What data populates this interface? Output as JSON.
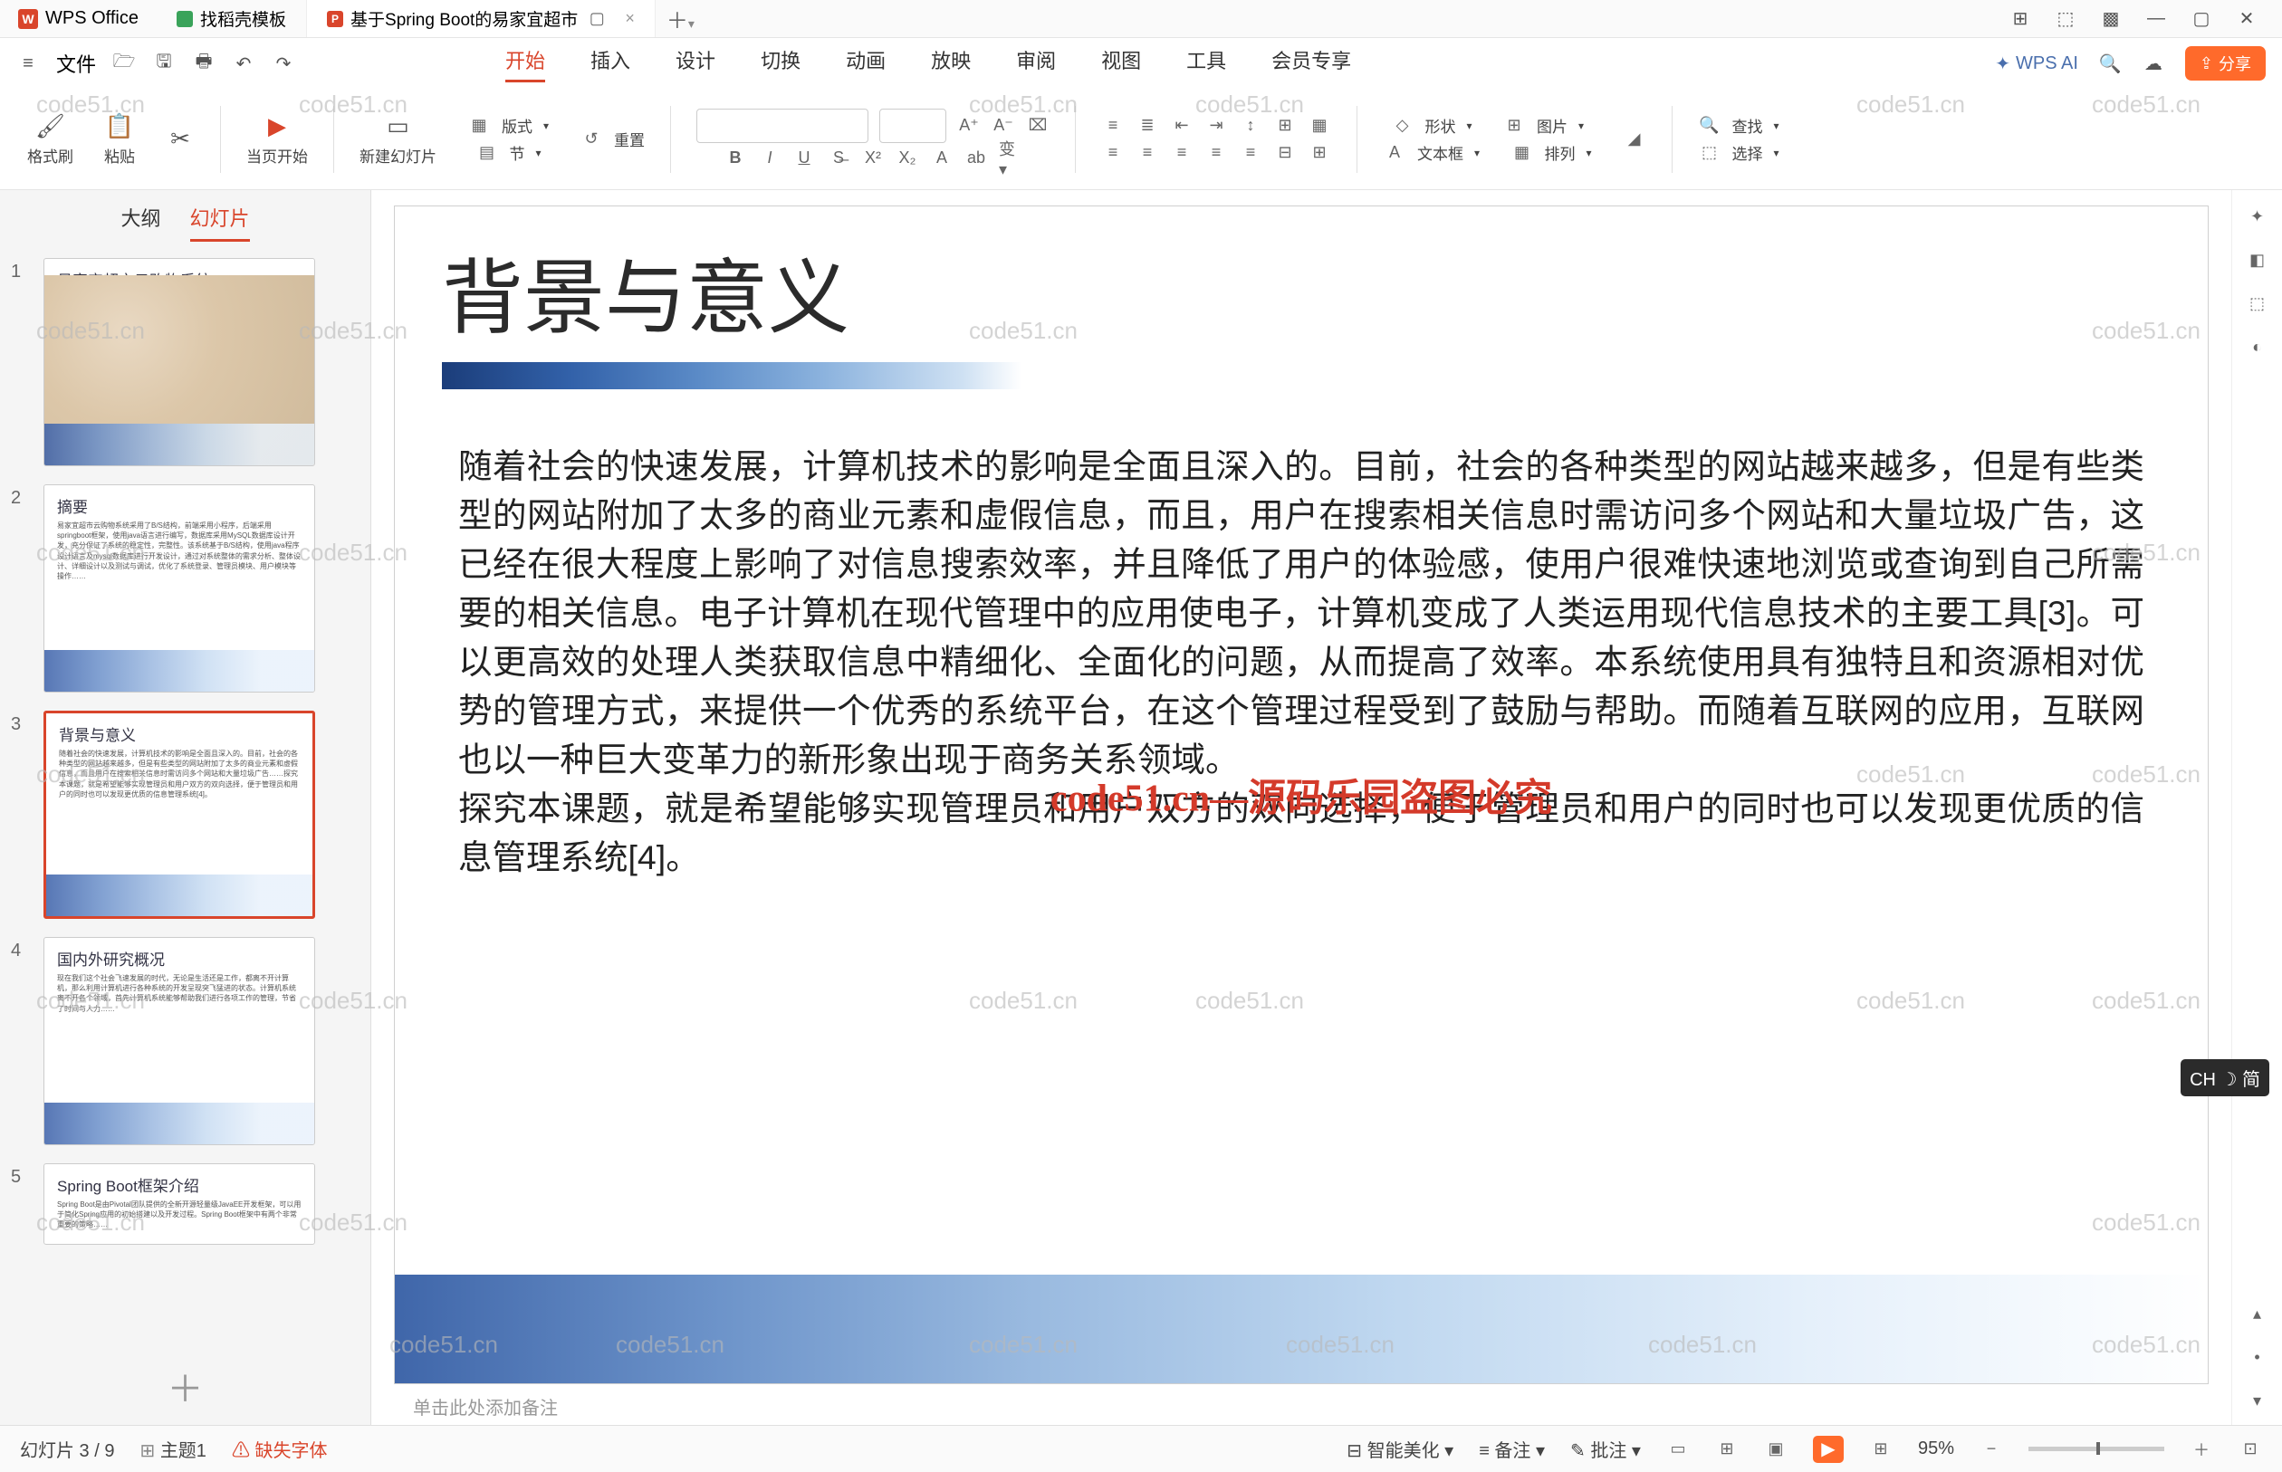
{
  "app": {
    "name": "WPS Office"
  },
  "tabs": [
    {
      "label": "找稻壳模板"
    },
    {
      "label": "基于Spring Boot的易家宜超市"
    }
  ],
  "menu": {
    "file": "文件",
    "items": [
      "开始",
      "插入",
      "设计",
      "切换",
      "动画",
      "放映",
      "审阅",
      "视图",
      "工具",
      "会员专享"
    ],
    "ai": "WPS AI",
    "share": "分享"
  },
  "ribbon": {
    "format_painter": "格式刷",
    "paste": "粘贴",
    "from_current": "当页开始",
    "new_slide": "新建幻灯片",
    "layout": "版式",
    "section": "节",
    "reset": "重置",
    "shape": "形状",
    "picture": "图片",
    "textbox": "文本框",
    "arrange": "排列",
    "find": "查找",
    "select": "选择"
  },
  "panel": {
    "outline": "大纲",
    "slides": "幻灯片"
  },
  "thumbs": [
    {
      "n": "1",
      "title": "易家宜超市云购物系统ppt"
    },
    {
      "n": "2",
      "title": "摘要"
    },
    {
      "n": "3",
      "title": "背景与意义"
    },
    {
      "n": "4",
      "title": "国内外研究概况"
    },
    {
      "n": "5",
      "title": "Spring Boot框架介绍"
    }
  ],
  "slide": {
    "title": "背景与意义",
    "para1": "随着社会的快速发展，计算机技术的影响是全面且深入的。目前，社会的各种类型的网站越来越多，但是有些类型的网站附加了太多的商业元素和虚假信息，而且，用户在搜索相关信息时需访问多个网站和大量垃圾广告，这已经在很大程度上影响了对信息搜索效率，并且降低了用户的体验感，使用户很难快速地浏览或查询到自己所需要的相关信息。电子计算机在现代管理中的应用使电子，计算机变成了人类运用现代信息技术的主要工具[3]。可以更高效的处理人类获取信息中精细化、全面化的问题，从而提高了效率。本系统使用具有独特且和资源相对优势的管理方式，来提供一个优秀的系统平台，在这个管理过程受到了鼓励与帮助。而随着互联网的应用，互联网也以一种巨大变革力的新形象出现于商务关系领域。",
    "para2": "探究本课题，就是希望能够实现管理员和用户双方的双向选择，便于管理员和用户的同时也可以发现更优质的信息管理系统[4]。"
  },
  "notes_placeholder": "单击此处添加备注",
  "status": {
    "slide": "幻灯片 3 / 9",
    "theme": "主题1",
    "fonts": "缺失字体",
    "beautify": "智能美化",
    "notes": "备注",
    "review": "批注",
    "zoom": "95%"
  },
  "watermark": "code51.cn",
  "watermark_red": "code51.cn—源码乐园盗图必究",
  "ime": "CH ☽ 简"
}
